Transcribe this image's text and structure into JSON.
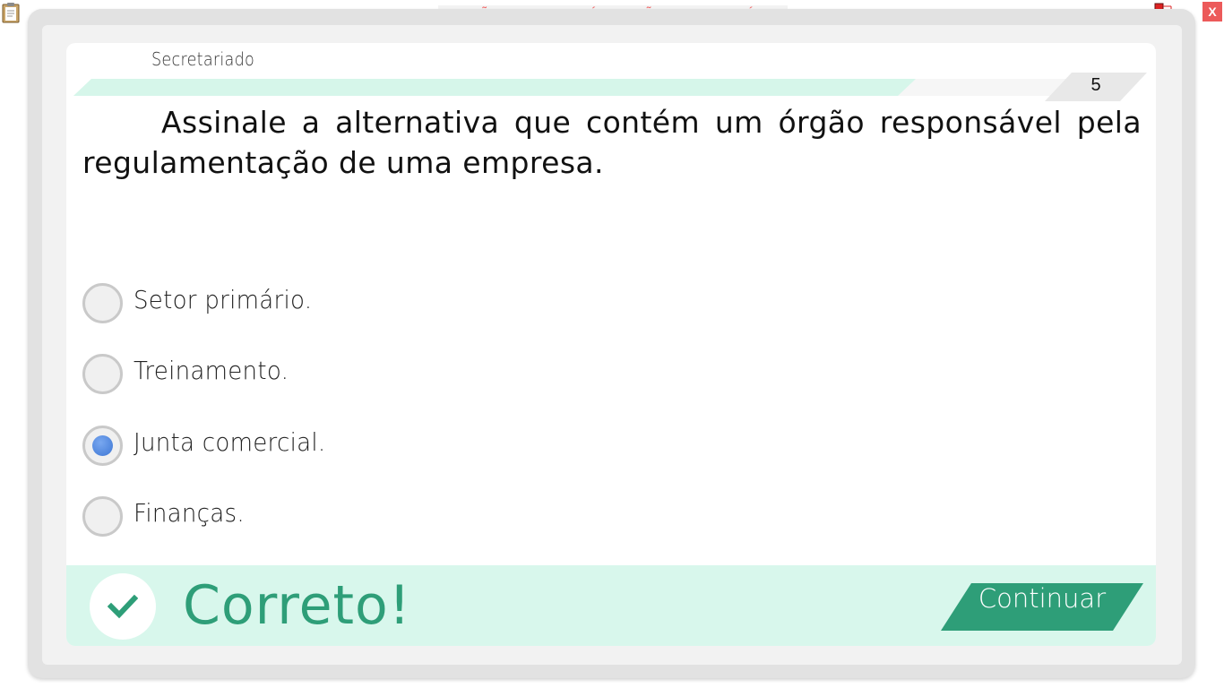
{
  "window": {
    "watermark": "VERSÃO PARA FUNCIONÁRIOS - NÃO COMERCIALIZÁVEL",
    "close_label": "X"
  },
  "header": {
    "subject": "Secretariado",
    "question_number": "5",
    "progress_fraction": 0.79
  },
  "question": {
    "text": "Assinale a alternativa que contém um órgão responsável pela regulamentação de uma empresa."
  },
  "options": [
    {
      "label": "Setor primário.",
      "selected": false
    },
    {
      "label": "Treinamento.",
      "selected": false
    },
    {
      "label": "Junta comercial.",
      "selected": true
    },
    {
      "label": "Finanças.",
      "selected": false
    }
  ],
  "feedback": {
    "status_text": "Correto!",
    "continue_label": "Continuar"
  },
  "colors": {
    "accent_green": "#2e9e78",
    "feedback_bg": "#d8f7ec",
    "radio_selected": "#3d76d4",
    "watermark_red": "#f26a6a"
  }
}
